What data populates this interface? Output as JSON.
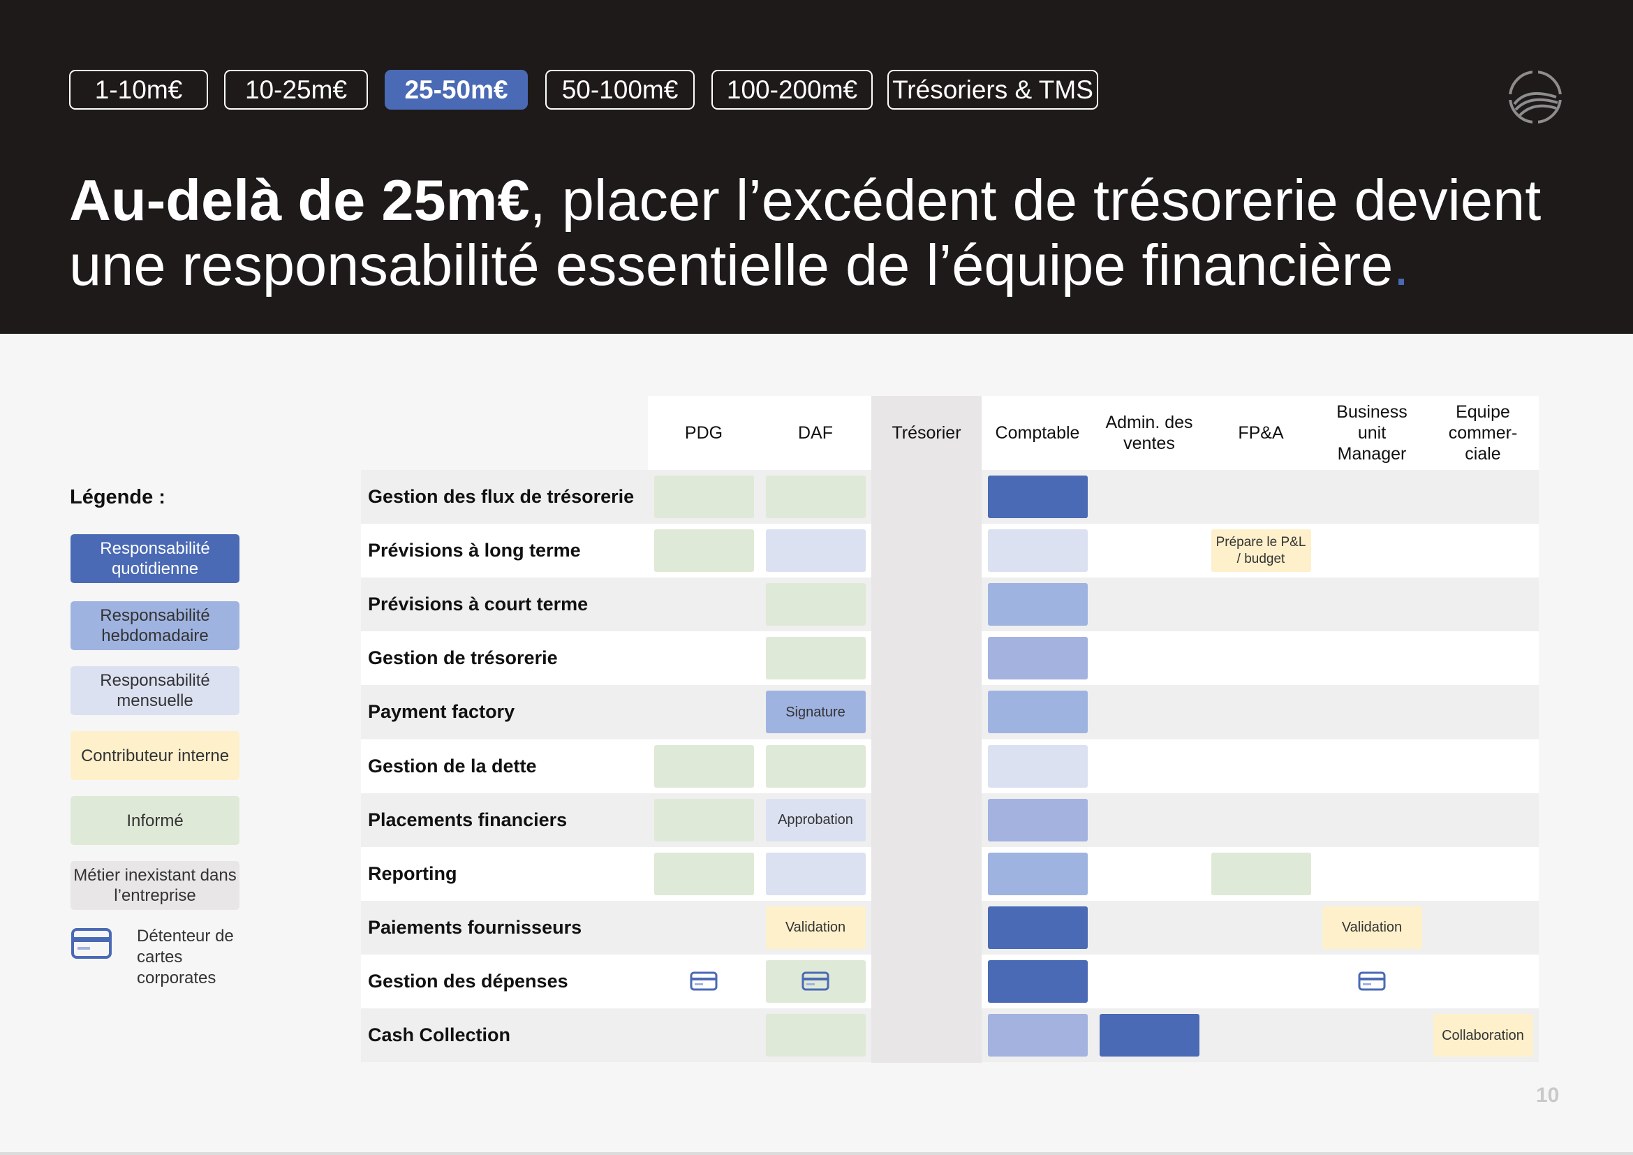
{
  "tabs": [
    {
      "label": "1-10m€",
      "active": false
    },
    {
      "label": "10-25m€",
      "active": false
    },
    {
      "label": "25-50m€",
      "active": true
    },
    {
      "label": "50-100m€",
      "active": false
    },
    {
      "label": "100-200m€",
      "active": false
    },
    {
      "label": "Trésoriers & TMS",
      "active": false
    }
  ],
  "title": {
    "bold": "Au-delà de 25m€",
    "rest": ", placer l’excédent de trésorerie devient une responsabilité essentielle de l’équipe financière",
    "dot": "."
  },
  "legend": {
    "title": "Légende :",
    "items": [
      {
        "label": "Responsabilité quotidienne",
        "color": "#4a6ab5",
        "text_color": "#ffffff"
      },
      {
        "label": "Responsabilité hebdomadaire",
        "color": "#9fb3e0",
        "text_color": "#333333"
      },
      {
        "label": "Responsabilité mensuelle",
        "color": "#dbe1f1",
        "text_color": "#333333"
      },
      {
        "label": "Contributeur interne",
        "color": "#fdf0cb",
        "text_color": "#333333"
      },
      {
        "label": "Informé",
        "color": "#dfe9d7",
        "text_color": "#333333"
      },
      {
        "label": "Métier inexistant dans l’entreprise",
        "color": "#e8e6e7",
        "text_color": "#333333"
      }
    ],
    "card_holder": "Détenteur de cartes corporates"
  },
  "colors": {
    "daily": "#4a6ab5",
    "weekly": "#9fb3e0",
    "weekly_alt": "#a3b2df",
    "monthly": "#dbe1f1",
    "contributor": "#fdf0cb",
    "informed": "#dfe9d7",
    "absent": "#e8e6e7",
    "card_icon": "#4a6ab5"
  },
  "columns": [
    "PDG",
    "DAF",
    "Trésorier",
    "Comptable",
    "Admin. des ventes",
    "FP&A",
    "Business unit Manager",
    "Equipe commer-ciale"
  ],
  "rows": [
    {
      "label": "Gestion des flux de trésorerie",
      "cells": [
        {
          "col": 0,
          "type": "informed"
        },
        {
          "col": 1,
          "type": "informed"
        },
        {
          "col": 3,
          "type": "daily"
        }
      ]
    },
    {
      "label": "Prévisions à long terme",
      "cells": [
        {
          "col": 0,
          "type": "informed"
        },
        {
          "col": 1,
          "type": "monthly"
        },
        {
          "col": 3,
          "type": "monthly"
        },
        {
          "col": 5,
          "type": "contributor",
          "text": "Prépare le P&L / budget"
        }
      ]
    },
    {
      "label": "Prévisions à court terme",
      "cells": [
        {
          "col": 1,
          "type": "informed"
        },
        {
          "col": 3,
          "type": "weekly"
        }
      ]
    },
    {
      "label": "Gestion de trésorerie",
      "cells": [
        {
          "col": 1,
          "type": "informed"
        },
        {
          "col": 3,
          "type": "weekly_alt"
        }
      ]
    },
    {
      "label": "Payment factory",
      "cells": [
        {
          "col": 1,
          "type": "weekly",
          "text": "Signature"
        },
        {
          "col": 3,
          "type": "weekly"
        }
      ]
    },
    {
      "label": "Gestion de la dette",
      "cells": [
        {
          "col": 0,
          "type": "informed"
        },
        {
          "col": 1,
          "type": "informed"
        },
        {
          "col": 3,
          "type": "monthly"
        }
      ]
    },
    {
      "label": "Placements financiers",
      "cells": [
        {
          "col": 0,
          "type": "informed"
        },
        {
          "col": 1,
          "type": "monthly",
          "text": "Approbation"
        },
        {
          "col": 3,
          "type": "weekly_alt"
        }
      ]
    },
    {
      "label": "Reporting",
      "cells": [
        {
          "col": 0,
          "type": "informed"
        },
        {
          "col": 1,
          "type": "monthly"
        },
        {
          "col": 3,
          "type": "weekly"
        },
        {
          "col": 5,
          "type": "informed"
        }
      ]
    },
    {
      "label": "Paiements fournisseurs",
      "cells": [
        {
          "col": 1,
          "type": "contributor",
          "text": "Validation"
        },
        {
          "col": 3,
          "type": "daily"
        },
        {
          "col": 6,
          "type": "contributor",
          "text": "Validation"
        }
      ]
    },
    {
      "label": "Gestion des dépenses",
      "cells": [
        {
          "col": 0,
          "type": "none",
          "card": true
        },
        {
          "col": 1,
          "type": "informed",
          "card": true
        },
        {
          "col": 3,
          "type": "daily"
        },
        {
          "col": 6,
          "type": "none",
          "card": true
        }
      ]
    },
    {
      "label": "Cash Collection",
      "cells": [
        {
          "col": 1,
          "type": "informed"
        },
        {
          "col": 3,
          "type": "weekly_alt"
        },
        {
          "col": 4,
          "type": "daily"
        },
        {
          "col": 7,
          "type": "contributor",
          "text": "Collaboration"
        }
      ]
    }
  ],
  "page_number": "10"
}
